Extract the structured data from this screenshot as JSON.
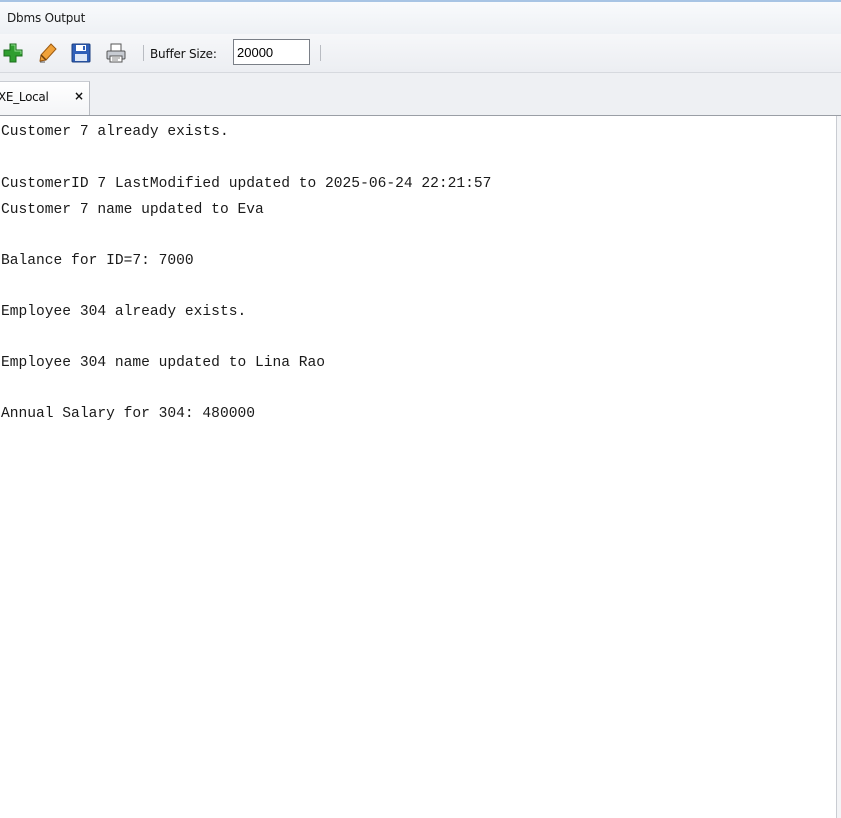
{
  "panel": {
    "title": "Dbms Output"
  },
  "toolbar": {
    "icons": [
      "add-icon",
      "eraser-icon",
      "save-icon",
      "print-icon"
    ],
    "buffer_label": "Buffer Size:",
    "buffer_value": "20000"
  },
  "tabs": [
    {
      "label": "XE_Local",
      "close": "×"
    }
  ],
  "output_lines": [
    "Customer 7 already exists.",
    "",
    "CustomerID 7 LastModified updated to 2025-06-24 22:21:57",
    "Customer 7 name updated to Eva",
    "",
    "Balance for ID=7: 7000",
    "",
    "Employee 304 already exists.",
    "",
    "Employee 304 name updated to Lina Rao",
    "",
    "Annual Salary for 304: 480000"
  ],
  "colors": {
    "accent_border": "#a8c4e4",
    "add_icon": "#2f9e2f",
    "save_icon": "#2f5fb8"
  }
}
